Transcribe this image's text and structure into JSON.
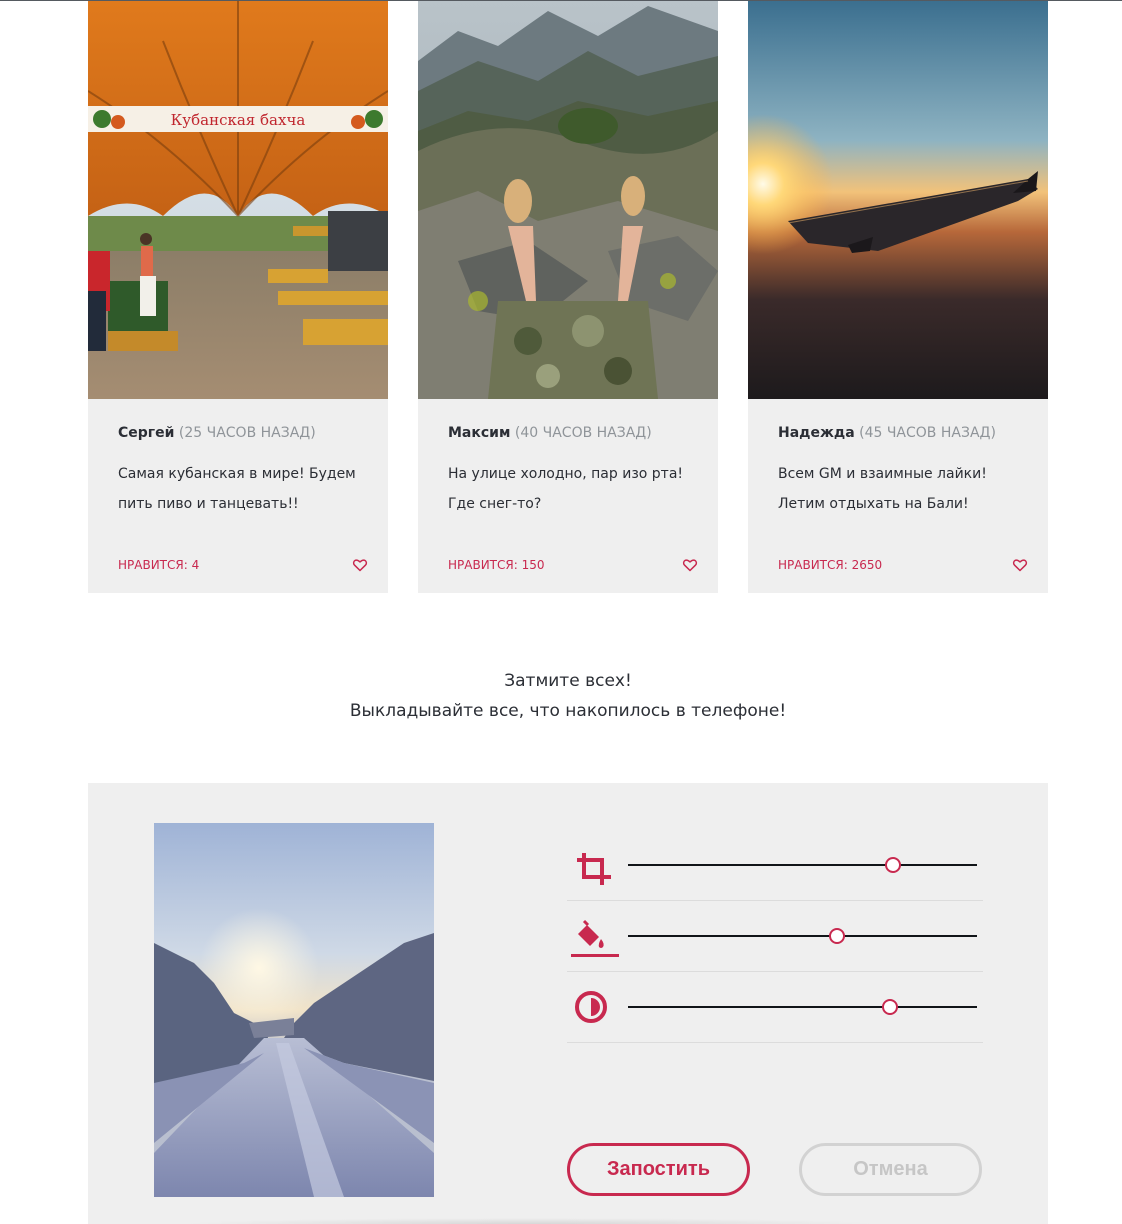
{
  "feed": {
    "cards": [
      {
        "author": "Сергей",
        "time": "(25 ЧАСОВ НАЗАД)",
        "text": "Самая кубанская в мире! Будем пить пиво и танцевать!!",
        "likes": "НРАВИТСЯ: 4",
        "banner": "Кубанская бахча"
      },
      {
        "author": "Максим",
        "time": "(40 ЧАСОВ НАЗАД)",
        "text": "На улице холодно, пар изо рта!Где снег-то?",
        "likes": "НРАВИТСЯ: 150"
      },
      {
        "author": "Надежда",
        "time": "(45 ЧАСОВ НАЗАД)",
        "text": "Всем GM и взаимные лайки! Летим отдыхать на Бали!",
        "likes": "НРАВИТСЯ: 2650"
      }
    ]
  },
  "slogan": {
    "line1": "Затмите всех!",
    "line2": "Выкладывайте все, что накопилось в телефоне!"
  },
  "editor": {
    "controls": [
      {
        "icon": "crop-icon",
        "value_fraction": 0.76
      },
      {
        "icon": "paint-bucket-icon",
        "value_fraction": 0.6
      },
      {
        "icon": "contrast-icon",
        "value_fraction": 0.75
      }
    ],
    "post_label": "Запостить",
    "cancel_label": "Отмена"
  },
  "colors": {
    "accent": "#c8294f",
    "card_bg": "#efefef",
    "text": "#2b2e35",
    "muted": "#8f9499",
    "disabled": "#c6c6c6"
  }
}
